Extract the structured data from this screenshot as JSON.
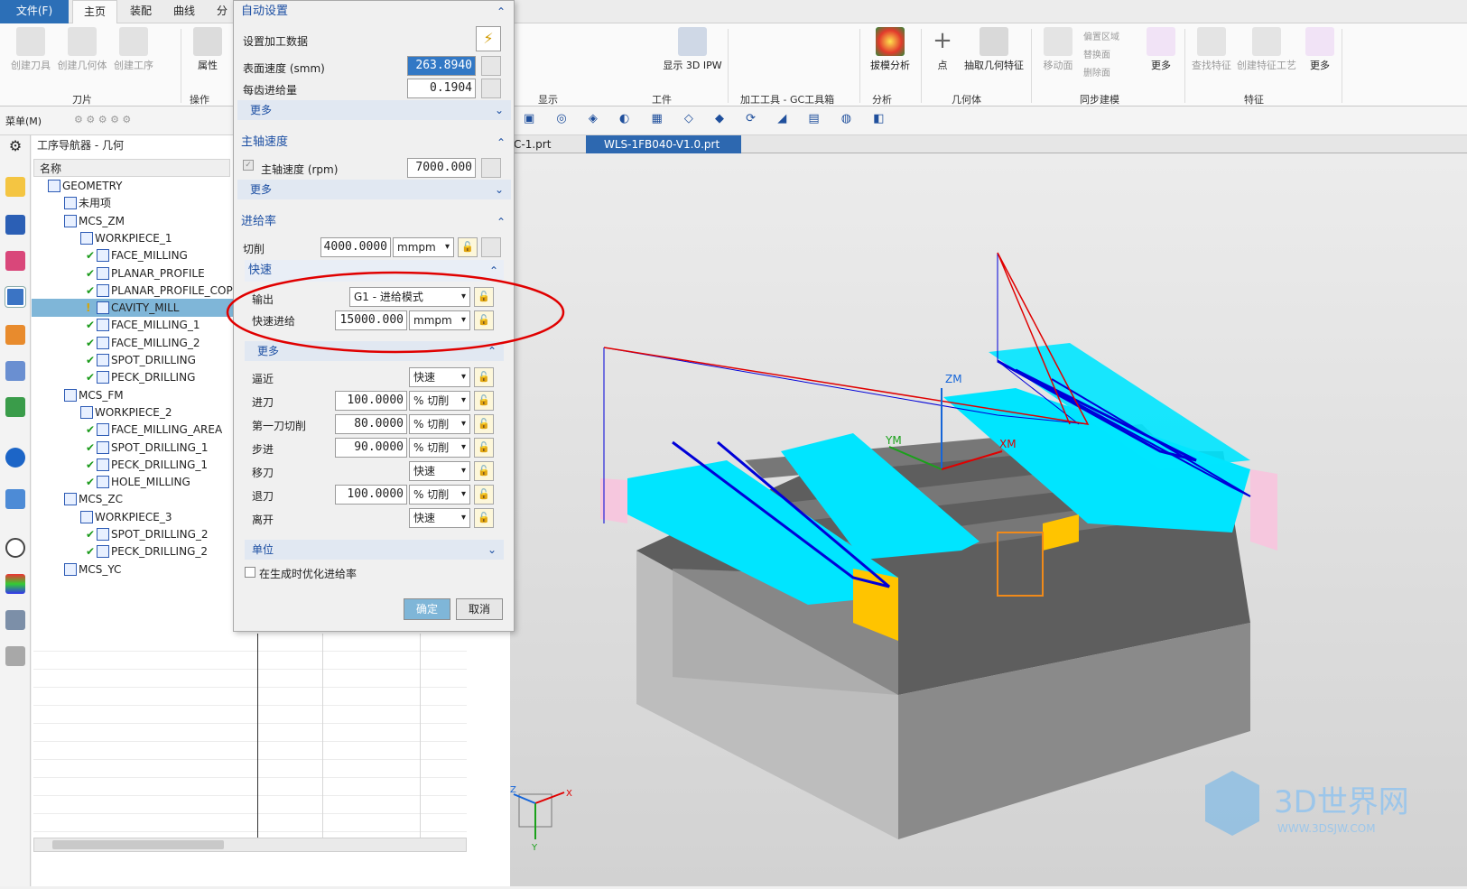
{
  "menubar": {
    "file": "文件(F)",
    "tabs": [
      "主页",
      "装配",
      "曲线",
      "分"
    ]
  },
  "ribbon": {
    "left_buttons": [
      "创建刀具",
      "创建几何体",
      "创建工序"
    ],
    "attr": "属性",
    "group_tool": "刀片",
    "group_op": "操作",
    "display_group": "显示",
    "workpiece_group": "工件",
    "show3d": "显示 3D IPW",
    "gc_group": "加工工具 - GC工具箱",
    "draft": "拔模分析",
    "analysis_group": "分析",
    "point": "点",
    "extract": "抽取几何特征",
    "geometry_group": "几何体",
    "move_face": "移动面",
    "offset_region": "偏置区域",
    "replace_face": "替换面",
    "delete_face": "删除面",
    "more": "更多",
    "sync_group": "同步建模",
    "find_feature": "查找特征",
    "create_feature": "创建特征工艺",
    "feature_group": "特征"
  },
  "qbar": {
    "menu": "菜单(M)"
  },
  "tabs": {
    "file1": "C-1.prt",
    "file2": "WLS-1FB040-V1.0.prt"
  },
  "navigator": {
    "title": "工序导航器 - 几何",
    "col_name": "名称",
    "rows": [
      {
        "label": "GEOMETRY",
        "level": 0,
        "check": false
      },
      {
        "label": "未用项",
        "level": 1,
        "check": false
      },
      {
        "label": "MCS_ZM",
        "level": 1,
        "check": false
      },
      {
        "label": "WORKPIECE_1",
        "level": 2,
        "check": false
      },
      {
        "label": "FACE_MILLING",
        "level": 3,
        "check": true
      },
      {
        "label": "PLANAR_PROFILE",
        "level": 3,
        "check": true
      },
      {
        "label": "PLANAR_PROFILE_COP",
        "level": 3,
        "check": true
      },
      {
        "label": "CAVITY_MILL",
        "level": 3,
        "check": false
      },
      {
        "label": "FACE_MILLING_1",
        "level": 3,
        "check": true
      },
      {
        "label": "FACE_MILLING_2",
        "level": 3,
        "check": true
      },
      {
        "label": "SPOT_DRILLING",
        "level": 3,
        "check": true
      },
      {
        "label": "PECK_DRILLING",
        "level": 3,
        "check": true
      },
      {
        "label": "MCS_FM",
        "level": 1,
        "check": false
      },
      {
        "label": "WORKPIECE_2",
        "level": 2,
        "check": false
      },
      {
        "label": "FACE_MILLING_AREA",
        "level": 3,
        "check": true
      },
      {
        "label": "SPOT_DRILLING_1",
        "level": 3,
        "check": true
      },
      {
        "label": "PECK_DRILLING_1",
        "level": 3,
        "check": true
      },
      {
        "label": "HOLE_MILLING",
        "level": 3,
        "check": true
      },
      {
        "label": "MCS_ZC",
        "level": 1,
        "check": false
      },
      {
        "label": "WORKPIECE_3",
        "level": 2,
        "check": false
      },
      {
        "label": "SPOT_DRILLING_2",
        "level": 3,
        "check": true
      },
      {
        "label": "PECK_DRILLING_2",
        "level": 3,
        "check": true
      },
      {
        "label": "MCS_YC",
        "level": 1,
        "check": false
      }
    ]
  },
  "dialog": {
    "auto_title": "自动设置",
    "set_data": "设置加工数据",
    "surface_speed_label": "表面速度 (smm)",
    "surface_speed": "263.8940",
    "feed_per_tooth_label": "每齿进给量",
    "feed_per_tooth": "0.1904",
    "more": "更多",
    "spindle_title": "主轴速度",
    "spindle_label": "主轴速度 (rpm)",
    "spindle": "7000.000",
    "feed_title": "进给率",
    "cut_label": "切削",
    "cut": "4000.0000",
    "cut_unit": "mmpm",
    "rapid_title": "快速",
    "output_label": "输出",
    "output": "G1 - 进给模式",
    "rapid_feed_label": "快速进给",
    "rapid_feed": "15000.000",
    "rapid_unit": "mmpm",
    "approach_label": "逼近",
    "approach": "快速",
    "engage_label": "进刀",
    "engage": "100.0000",
    "engage_unit": "% 切削",
    "first_cut_label": "第一刀切削",
    "first_cut": "80.0000",
    "first_cut_unit": "% 切削",
    "stepover_label": "步进",
    "stepover": "90.0000",
    "stepover_unit": "% 切削",
    "traverse_label": "移刀",
    "traverse": "快速",
    "retract_label": "退刀",
    "retract": "100.0000",
    "retract_unit": "% 切削",
    "depart_label": "离开",
    "depart": "快速",
    "units_title": "单位",
    "optimize_label": "在生成时优化进给率",
    "ok": "确定",
    "cancel": "取消"
  },
  "viewport": {
    "axis_zm": "ZM",
    "axis_ym": "YM",
    "axis_xm": "XM",
    "triad_z": "Z",
    "triad_x": "X",
    "triad_y": "Y",
    "watermark": "3D世界网",
    "watermark_url": "WWW.3DSJW.COM"
  },
  "colors": {
    "accent": "#1c4fa3",
    "highlight": "#7fb6d8",
    "cyan": "#00e5ff",
    "toolpath": "#0000d8"
  }
}
